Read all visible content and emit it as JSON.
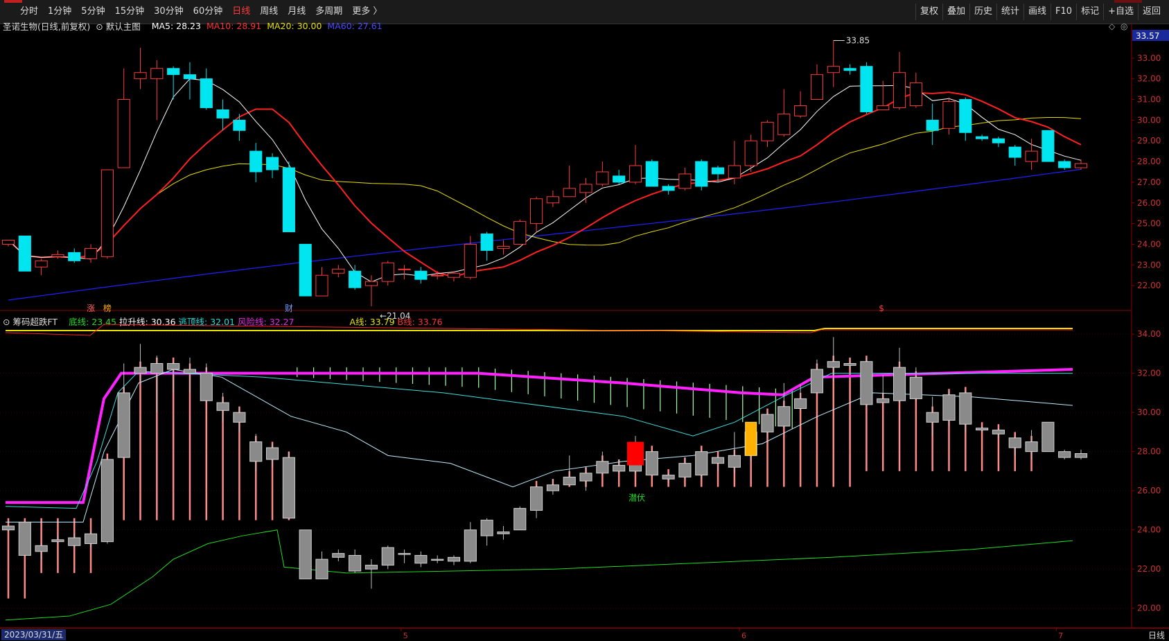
{
  "toolbar": {
    "close": "✕",
    "periods": [
      "分时",
      "1分钟",
      "5分钟",
      "15分钟",
      "30分钟",
      "60分钟",
      "日线",
      "周线",
      "月线",
      "多周期",
      "更多 〉"
    ],
    "active_period": "日线",
    "tools": [
      "复权",
      "叠加",
      "历史",
      "统计",
      "画线",
      "F10",
      "标记",
      "+自选",
      "返回"
    ]
  },
  "main_legend": {
    "stock": "圣诺生物(日线,前复权)",
    "mode": "默认主图",
    "ma5": "MA5: 28.23",
    "ma10": "MA10: 28.91",
    "ma20": "MA20: 30.00",
    "ma60": "MA60: 27.61",
    "ma5_color": "#ffffff",
    "ma10_color": "#ff2020",
    "ma20_color": "#e8e000",
    "ma60_color": "#2020ff"
  },
  "main_panel": {
    "price_box": "33.57",
    "high_label": "33.85",
    "low_label": "21.04",
    "markers": [
      "涨",
      "榜",
      "财",
      "$"
    ],
    "y_ticks": [
      "33.00",
      "32.00",
      "31.00",
      "30.00",
      "29.00",
      "28.00",
      "27.00",
      "26.00",
      "25.00",
      "24.00",
      "23.00",
      "22.00"
    ]
  },
  "sub_legend": {
    "name": "筹码超跌FT",
    "bottom": "底线: 23.45",
    "pull": "拉升线: 30.36",
    "escape": "逃顶线: 32.01",
    "risk": "风险线: 32.27",
    "a": "A线: 33.79",
    "b": "B线: 33.76",
    "signal": "潜伏",
    "y_ticks": [
      "34.00",
      "32.00",
      "30.00",
      "28.00",
      "26.00",
      "24.00",
      "22.00",
      "20.00"
    ]
  },
  "status_bar": {
    "date": "2023/03/31/五",
    "months": [
      "5",
      "6",
      "7"
    ],
    "right_label": "日线"
  },
  "chart_data": {
    "type": "candlestick",
    "ylim_main": [
      21.0,
      34.2
    ],
    "ylim_sub": [
      19.0,
      34.5
    ],
    "candles": [
      [
        24.0,
        24.2,
        24.1,
        23.9
      ],
      [
        24.4,
        22.7,
        24.4,
        22.7
      ],
      [
        22.9,
        23.2,
        23.3,
        22.5
      ],
      [
        23.4,
        23.5,
        23.7,
        23.3
      ],
      [
        23.6,
        23.2,
        23.8,
        23.1
      ],
      [
        23.3,
        23.8,
        24.0,
        23.1
      ],
      [
        23.4,
        27.6,
        27.6,
        23.3
      ],
      [
        27.7,
        31.0,
        32.5,
        27.7
      ],
      [
        32.0,
        32.3,
        33.5,
        31.5
      ],
      [
        32.0,
        32.5,
        32.9,
        30.0
      ],
      [
        32.5,
        32.2,
        32.6,
        31.0
      ],
      [
        32.2,
        32.0,
        32.8,
        31.0
      ],
      [
        32.0,
        30.6,
        32.5,
        30.5
      ],
      [
        30.5,
        30.1,
        31.0,
        29.5
      ],
      [
        30.0,
        29.5,
        30.3,
        29.0
      ],
      [
        28.5,
        27.5,
        28.9,
        27.0
      ],
      [
        28.2,
        27.6,
        28.4,
        27.2
      ],
      [
        27.7,
        24.6,
        28.0,
        24.6
      ],
      [
        24.0,
        21.5,
        24.0,
        21.5
      ],
      [
        21.5,
        22.5,
        22.9,
        21.5
      ],
      [
        22.6,
        22.8,
        23.0,
        22.4
      ],
      [
        22.7,
        21.9,
        23.0,
        21.8
      ],
      [
        22.0,
        22.2,
        22.5,
        21.0
      ],
      [
        22.2,
        23.1,
        23.2,
        22.0
      ],
      [
        22.8,
        22.8,
        23.0,
        22.3
      ],
      [
        22.7,
        22.3,
        22.9,
        22.1
      ],
      [
        22.5,
        22.5,
        22.7,
        22.3
      ],
      [
        22.4,
        22.6,
        22.7,
        22.2
      ],
      [
        22.4,
        24.0,
        24.4,
        22.3
      ],
      [
        24.5,
        23.7,
        24.6,
        23.2
      ],
      [
        23.8,
        23.9,
        24.2,
        23.5
      ],
      [
        24.0,
        25.1,
        25.2,
        24.0
      ],
      [
        25.0,
        26.2,
        26.3,
        24.6
      ],
      [
        26.0,
        26.3,
        26.6,
        25.8
      ],
      [
        26.3,
        26.7,
        27.8,
        26.3
      ],
      [
        26.5,
        26.9,
        27.2,
        26.0
      ],
      [
        26.9,
        27.5,
        28.0,
        26.8
      ],
      [
        27.3,
        27.0,
        27.6,
        26.9
      ],
      [
        27.0,
        27.8,
        28.8,
        26.9
      ],
      [
        28.0,
        26.8,
        28.1,
        26.8
      ],
      [
        26.8,
        26.6,
        26.9,
        26.4
      ],
      [
        26.7,
        27.4,
        27.7,
        26.6
      ],
      [
        28.0,
        26.8,
        28.1,
        26.6
      ],
      [
        27.7,
        27.4,
        27.8,
        27.0
      ],
      [
        27.2,
        27.8,
        29.0,
        26.9
      ],
      [
        27.8,
        29.0,
        29.3,
        27.5
      ],
      [
        29.0,
        29.9,
        30.0,
        28.7
      ],
      [
        29.3,
        30.3,
        31.5,
        29.2
      ],
      [
        30.2,
        30.7,
        31.4,
        30.1
      ],
      [
        31.0,
        32.2,
        32.7,
        31.0
      ],
      [
        32.3,
        32.6,
        33.85,
        31.6
      ],
      [
        32.5,
        32.4,
        32.7,
        32.2
      ],
      [
        32.6,
        30.4,
        32.8,
        30.3
      ],
      [
        30.5,
        30.7,
        31.9,
        30.5
      ],
      [
        30.6,
        32.3,
        33.3,
        30.5
      ],
      [
        30.7,
        31.8,
        32.3,
        30.6
      ],
      [
        30.0,
        29.5,
        30.8,
        28.8
      ],
      [
        29.6,
        30.9,
        31.1,
        29.3
      ],
      [
        31.0,
        29.4,
        31.1,
        29.0
      ],
      [
        29.2,
        29.1,
        29.3,
        29.0
      ],
      [
        29.1,
        28.9,
        29.2,
        28.7
      ],
      [
        28.7,
        28.2,
        28.8,
        27.8
      ],
      [
        28.0,
        28.5,
        29.1,
        27.6
      ],
      [
        29.5,
        28.0,
        29.5,
        28.0
      ],
      [
        28.0,
        27.7,
        28.1,
        27.6
      ],
      [
        27.7,
        27.9,
        28.1,
        27.6
      ]
    ],
    "ma_main": {
      "ma5": "MA5: 28.23",
      "ma10": "MA10: 28.91",
      "ma20": "MA20: 30.00",
      "ma60": "MA60: 27.61"
    }
  }
}
